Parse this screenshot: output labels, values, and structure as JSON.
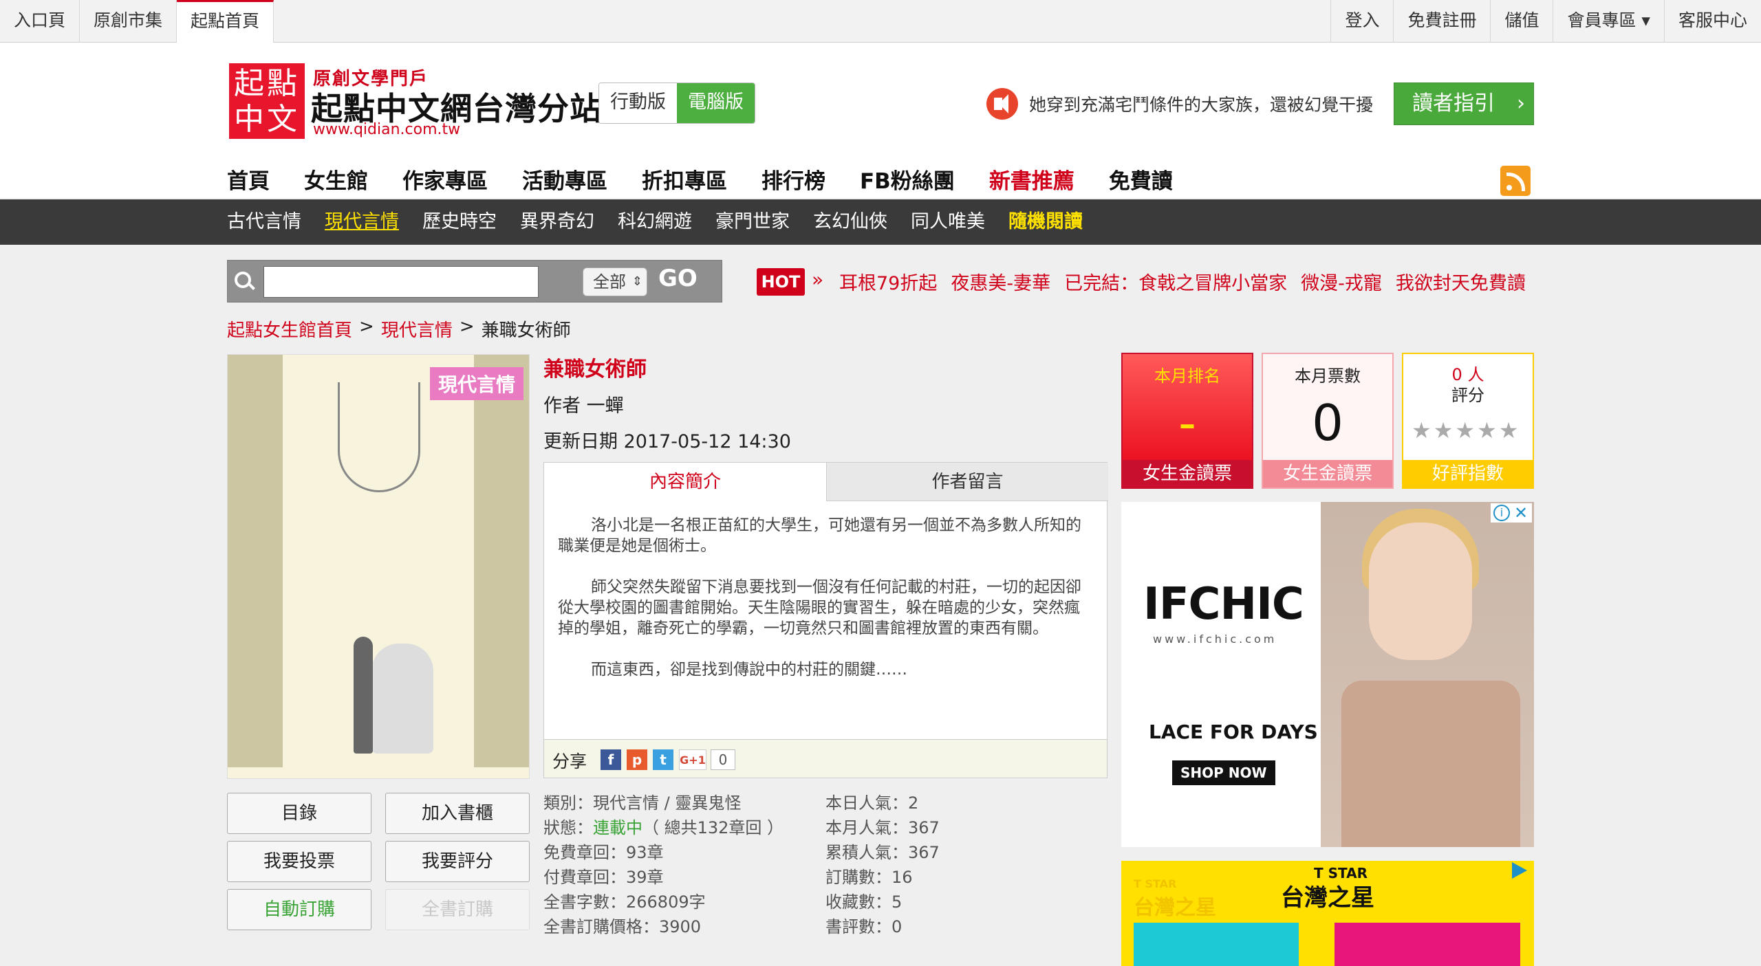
{
  "topbar": {
    "left": [
      "入口頁",
      "原創市集",
      "起點首頁"
    ],
    "right": [
      "登入",
      "免費註冊",
      "儲值",
      "會員專區 ▾",
      "客服中心"
    ]
  },
  "logo": {
    "seal": "起點中文",
    "sub": "原創文學門戶",
    "title": "起點中文網台灣分站",
    "url": "www.qidian.com.tw"
  },
  "version": {
    "mobile": "行動版",
    "pc": "電腦版"
  },
  "notice": "她穿到充滿宅鬥條件的大家族，還被幻覺干擾",
  "guide_button": "讀者指引",
  "main_nav": [
    "首頁",
    "女生館",
    "作家專區",
    "活動專區",
    "折扣專區",
    "排行榜",
    "FB粉絲團",
    "新書推薦",
    "免費讀"
  ],
  "sub_nav": [
    "古代言情",
    "現代言情",
    "歷史時空",
    "異界奇幻",
    "科幻網遊",
    "豪門世家",
    "玄幻仙俠",
    "同人唯美",
    "隨機閱讀"
  ],
  "search": {
    "placeholder": "",
    "select": "全部",
    "go": "GO"
  },
  "hot": {
    "badge": "HOT",
    "links": [
      "耳根79折起",
      "夜惠美-妻華",
      "已完結：食戟之冒牌小當家",
      "微漫-戎寵",
      "我欲封天免費讀"
    ]
  },
  "breadcrumb": [
    "起點女生館首頁",
    "現代言情",
    "兼職女術師"
  ],
  "cover": {
    "badge": "現代言情"
  },
  "book": {
    "title": "兼職女術師",
    "author": "作者 一蟬",
    "updated": "更新日期 2017-05-12 14:30"
  },
  "tabs": [
    "內容簡介",
    "作者留言"
  ],
  "intro": [
    "洛小北是一名根正苗紅的大學生，可她還有另一個並不為多數人所知的職業便是她是個術士。",
    "師父突然失蹤留下消息要找到一個沒有任何記載的村莊，一切的起因卻從大學校園的圖書館開始。天生陰陽眼的實習生，躲在暗處的少女，突然瘋掉的學姐，離奇死亡的學霸，一切竟然只和圖書館裡放置的東西有關。",
    "而這東西，卻是找到傳說中的村莊的關鍵……"
  ],
  "share": {
    "label": "分享",
    "fb": "f",
    "plurk": "p",
    "twitter": "t",
    "gplus": "G+1",
    "count": "0"
  },
  "buttons": [
    "目錄",
    "加入書櫃",
    "我要投票",
    "我要評分",
    "自動訂購",
    "全書訂購"
  ],
  "info_left": {
    "category": "類別：現代言情 / 靈異鬼怪",
    "status_label": "狀態：",
    "status_value": "連載中",
    "status_tail": "（ 總共132章回 ）",
    "free": "免費章回：93章",
    "paid": "付費章回：39章",
    "words": "全書字數：266809字",
    "price": "全書訂購價格：3900"
  },
  "info_right": [
    "本日人氣：2",
    "本月人氣：367",
    "累積人氣：367",
    "訂購數：16",
    "收藏數：5",
    "書評數：0"
  ],
  "stats": {
    "rank": {
      "label": "本月排名",
      "value": "-",
      "foot": "女生金讀票"
    },
    "votes": {
      "label": "本月票數",
      "value": "0",
      "foot": "女生金讀票"
    },
    "rating": {
      "count": "0 人",
      "label": "評分",
      "foot": "好評指數",
      "stars": 0
    }
  },
  "ad1": {
    "brand": "IFCHIC",
    "url": "www.ifchic.com",
    "tagline": "LACE FOR DAYS",
    "cta": "SHOP NOW"
  },
  "ad2": {
    "small": "T STAR",
    "title": "台灣之星",
    "ghost_small": "T STAR",
    "ghost": "台灣之星"
  }
}
